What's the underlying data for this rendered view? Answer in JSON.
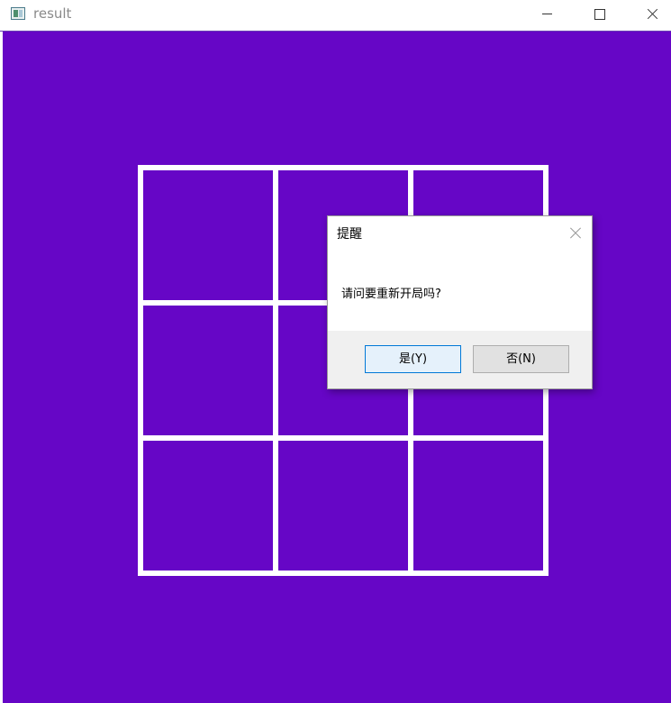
{
  "window": {
    "title": "result",
    "icon": "app-window-icon",
    "controls": [
      "minimize-icon",
      "maximize-icon",
      "close-icon"
    ]
  },
  "canvas": {
    "background_color": "#6606c6",
    "grid_color": "#ffffff",
    "board": {
      "rows": 3,
      "cols": 3,
      "cells": [
        "",
        "",
        "",
        "",
        "",
        "",
        "",
        "",
        ""
      ]
    }
  },
  "dialog": {
    "title": "提醒",
    "message": "请问要重新开局吗?",
    "yes_label": "是(Y)",
    "no_label": "否(N)"
  }
}
